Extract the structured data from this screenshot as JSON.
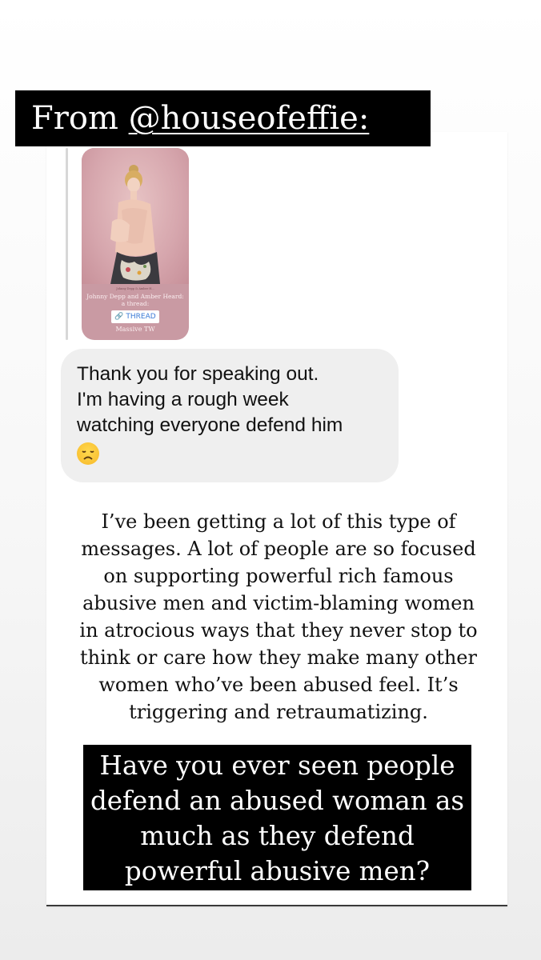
{
  "header": {
    "prefix": "From ",
    "handle": "@houseofeffie:"
  },
  "shared_post": {
    "small_text": "Johnny Depp & Amber H...",
    "caption": "Johnny Depp and Amber Heard: a thread:",
    "tag_icon": "link-icon",
    "tag_label": "THREAD",
    "warning": "Massive TW"
  },
  "message": {
    "lines": [
      "Thank you for speaking out.",
      "I'm having a rough week",
      "watching everyone defend him"
    ],
    "emoji": "disappointed-face-emoji"
  },
  "caption": {
    "lines": [
      "I’ve been getting a lot of this type of",
      "messages. A lot of people are so focused",
      "on supporting powerful rich famous",
      "abusive men and victim-blaming women",
      "in atrocious ways that they never stop to",
      "think or care how they make many other",
      "women who’ve been abused feel. It’s",
      "triggering and retraumatizing."
    ]
  },
  "question": {
    "lines": [
      "Have you ever seen people",
      "defend an abused woman as",
      "much as they defend",
      "powerful abusive men?"
    ]
  },
  "colors": {
    "label_bg": "#000000",
    "bubble_bg": "#efefef",
    "link_blue": "#3a7ad6",
    "post_bg": "#c99aa3"
  }
}
